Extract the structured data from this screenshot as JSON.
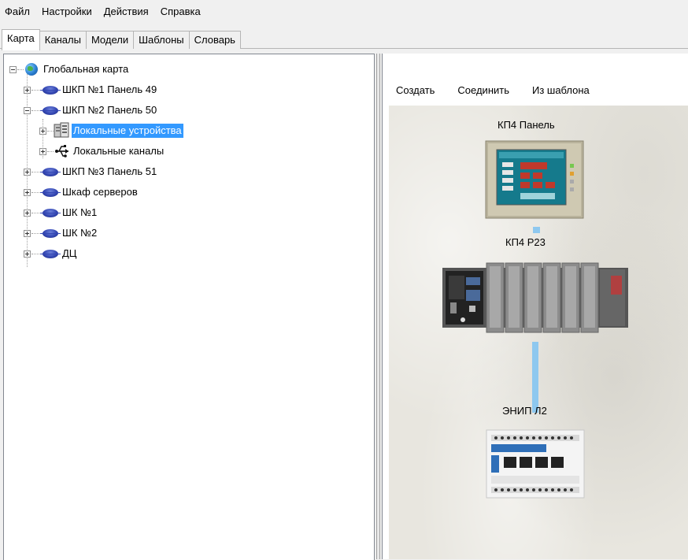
{
  "menu": [
    "Файл",
    "Настройки",
    "Действия",
    "Справка"
  ],
  "tabs": [
    "Карта",
    "Каналы",
    "Модели",
    "Шаблоны",
    "Словарь"
  ],
  "active_tab": "Карта",
  "tree": {
    "root": "Глобальная карта",
    "nodes": [
      {
        "label": "ШКП №1 Панель 49"
      },
      {
        "label": "ШКП №2 Панель 50",
        "children": [
          {
            "label": "Локальные устройства",
            "selected": true
          },
          {
            "label": "Локальные каналы"
          }
        ]
      },
      {
        "label": "ШКП №3 Панель 51"
      },
      {
        "label": "Шкаф серверов"
      },
      {
        "label": "ШК №1"
      },
      {
        "label": "ШК №2"
      },
      {
        "label": "ДЦ"
      }
    ]
  },
  "toolbar": {
    "create": "Создать",
    "connect": "Соединить",
    "from_template": "Из шаблона"
  },
  "devices": [
    {
      "label": "КП4 Панель",
      "icon": "touch-panel-device-icon"
    },
    {
      "label": "КП4 Р23",
      "icon": "plc-rack-device-icon"
    },
    {
      "label": "ЭНИП Л2",
      "icon": "network-switch-device-icon"
    }
  ],
  "colors": {
    "selection": "#3399ff",
    "link": "#8ec8ef",
    "node_disc": "#3447b3"
  }
}
